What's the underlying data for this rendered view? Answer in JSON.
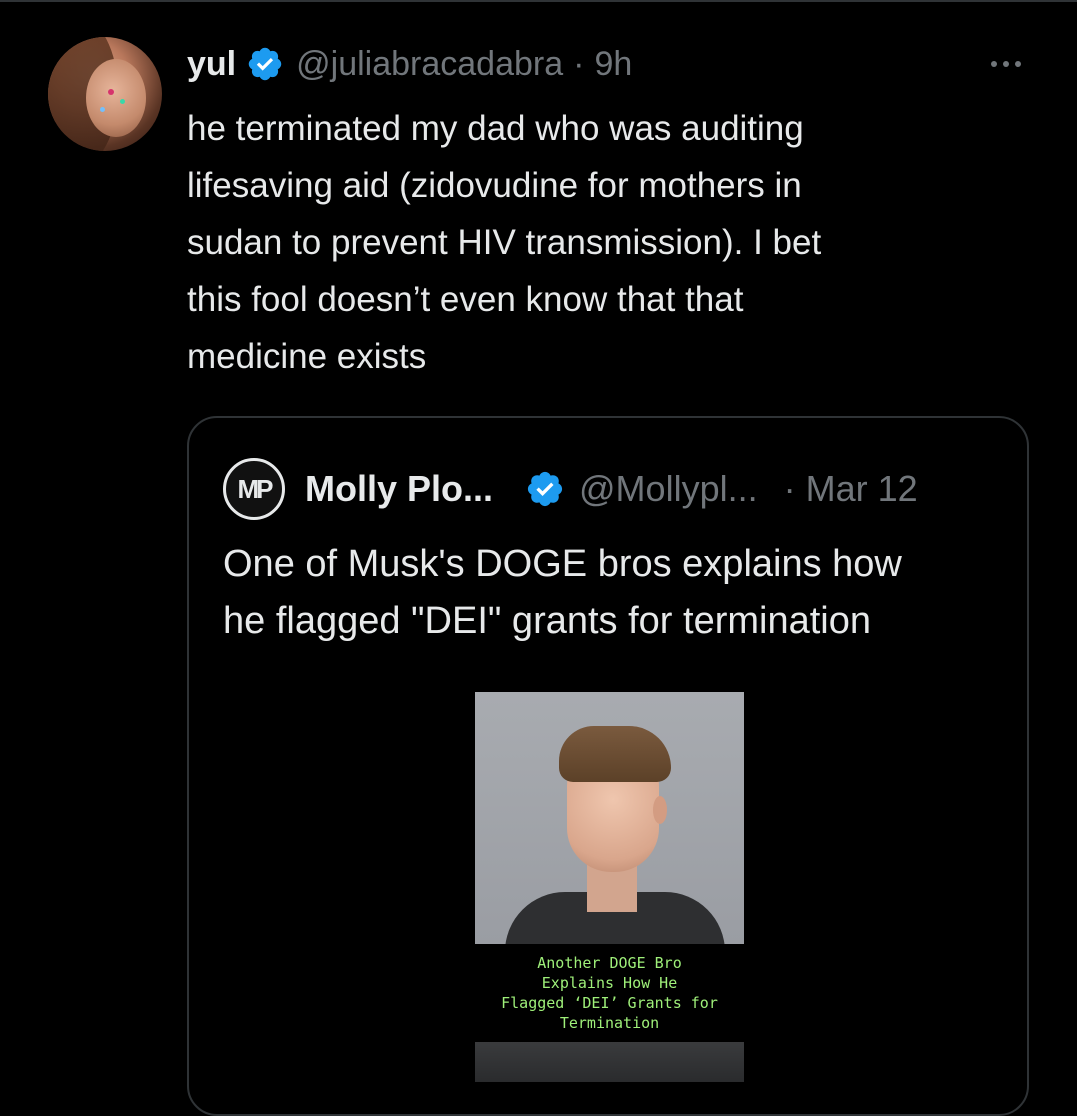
{
  "tweet": {
    "display_name": "yul",
    "handle": "@juliabracadabra",
    "separator": "·",
    "time": "9h",
    "text_lines": [
      "he terminated my dad who was auditing",
      "lifesaving aid (zidovudine for mothers in",
      "sudan to prevent HIV transmission). I bet",
      "this fool doesn’t even know that that",
      "medicine exists"
    ]
  },
  "quote": {
    "avatar_initials": "MP",
    "display_name": "Molly Plo...",
    "handle": "@Mollypl...",
    "separator": "·",
    "time": "Mar 12",
    "text_lines": [
      "One of Musk's DOGE bros explains how",
      "he flagged \"DEI\" grants for termination"
    ],
    "media": {
      "caption_lines": [
        "Another DOGE Bro",
        "Explains How He",
        "Flagged ‘DEI’ Grants for",
        "Termination"
      ]
    }
  },
  "icons": {
    "verified": "verified-badge-icon",
    "more": "more-horizontal-icon"
  },
  "colors": {
    "background": "#000000",
    "text": "#e7e9ea",
    "secondary": "#71767b",
    "verified_blue": "#1d9bf0",
    "border": "#2f3336",
    "caption_green": "#9ff07a"
  }
}
